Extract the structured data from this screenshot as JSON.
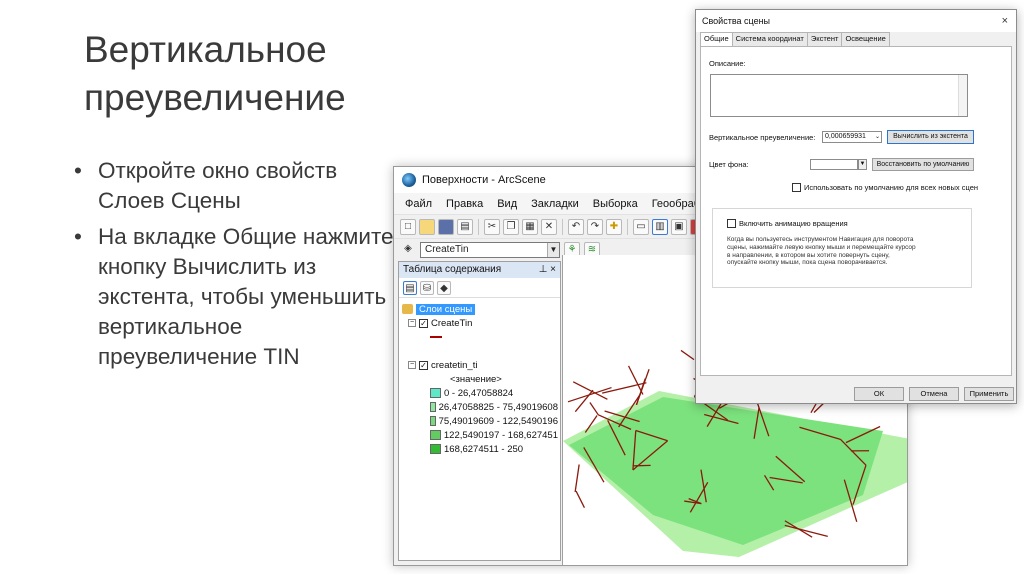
{
  "slide": {
    "title": "Вертикальное преувеличение",
    "bullets": [
      "Откройте окно свойств Слоев Сцены",
      "На вкладке Общие нажмите кнопку Вычислить из экстента, чтобы уменьшить вертикальное преувеличение TIN"
    ]
  },
  "arcscene": {
    "title": "Поверхности - ArcScene",
    "menu": [
      "Файл",
      "Правка",
      "Вид",
      "Закладки",
      "Выборка",
      "Геообработка"
    ],
    "layer_select": "CreateTin",
    "toc": {
      "header": "Таблица содержания",
      "pins": "⊥ ×",
      "root": "Слои сцены",
      "layer1": "CreateTin",
      "layer2": "createtin_ti",
      "field": "<значение>",
      "classes": [
        {
          "label": "0 - 26,47058824",
          "color": "#5ee8c8"
        },
        {
          "label": "26,47058825 - 75,49019608",
          "color": "#8ee79c"
        },
        {
          "label": "75,49019609 - 122,5490196",
          "color": "#7ad87e"
        },
        {
          "label": "122,5490197 - 168,627451",
          "color": "#62cc62"
        },
        {
          "label": "168,6274511 - 250",
          "color": "#33bb33"
        }
      ]
    },
    "colors": {
      "tin_edges": "#8b1a0e",
      "tin_fill": "#7be27d",
      "tin_base": "#b4f0a8"
    }
  },
  "dialog": {
    "title": "Свойства сцены",
    "close": "×",
    "tabs": [
      "Общие",
      "Система координат",
      "Экстент",
      "Освещение"
    ],
    "description_label": "Описание:",
    "vertical_exaggeration_label": "Вертикальное преувеличение:",
    "vertical_exaggeration_value": "0,000659931",
    "calc_button": "Вычислить из экстента",
    "background_label": "Цвет фона:",
    "restore_default": "Восстановить по умолчанию",
    "use_default_label": "Использовать по умолчанию для всех новых сцен",
    "enable_rotation_label": "Включить анимацию вращения",
    "rotation_desc": "Когда вы пользуетесь инструментом Навигация для поворота сцены, нажимайте левую кнопку мыши и перемещайте курсор в направлении, в котором вы хотите повернуть сцену, опускайте кнопку мыши, пока сцена поворачивается.",
    "buttons": {
      "ok": "ОК",
      "cancel": "Отмена",
      "apply": "Применить"
    }
  }
}
